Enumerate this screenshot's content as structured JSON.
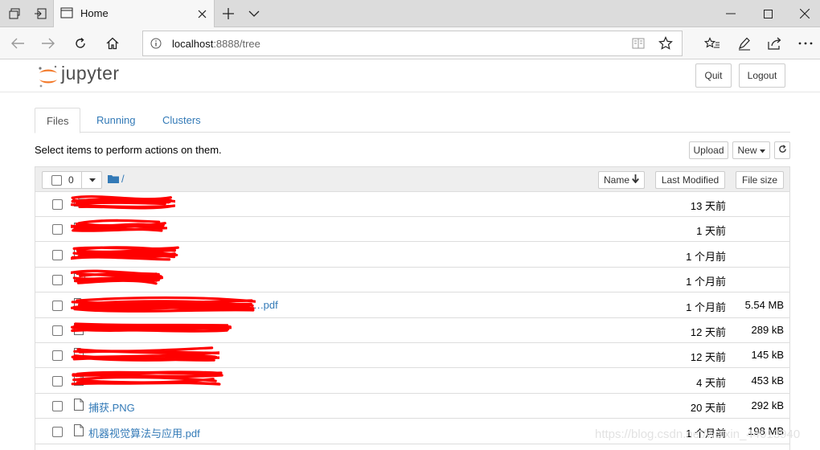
{
  "browser": {
    "tab_title": "Home",
    "url_host": "localhost",
    "url_rest": ":8888/tree"
  },
  "header": {
    "logo_text": "jupyter",
    "quit_label": "Quit",
    "logout_label": "Logout"
  },
  "tabs": [
    {
      "label": "Files"
    },
    {
      "label": "Running"
    },
    {
      "label": "Clusters"
    }
  ],
  "hint": "Select items to perform actions on them.",
  "toolbar": {
    "upload_label": "Upload",
    "new_label": "New"
  },
  "list_header": {
    "selected_count": "0",
    "path": "/",
    "col_name": "Name",
    "col_modified": "Last Modified",
    "col_size": "File size"
  },
  "files": [
    {
      "name": "",
      "modified": "13 天前",
      "size": "",
      "type": "folder",
      "redacted": true
    },
    {
      "name": "",
      "modified": "1 天前",
      "size": "",
      "type": "folder",
      "redacted": true
    },
    {
      "name": "",
      "modified": "1 个月前",
      "size": "",
      "type": "folder",
      "redacted": true
    },
    {
      "name": "",
      "modified": "1 个月前",
      "size": "",
      "type": "folder",
      "redacted": true
    },
    {
      "name": "…….pdf",
      "modified": "1 个月前",
      "size": "5.54 MB",
      "type": "file",
      "redacted": true
    },
    {
      "name": "",
      "modified": "12 天前",
      "size": "289 kB",
      "type": "file",
      "redacted": true
    },
    {
      "name": "",
      "modified": "12 天前",
      "size": "145 kB",
      "type": "file",
      "redacted": true
    },
    {
      "name": "",
      "modified": "4 天前",
      "size": "453 kB",
      "type": "file",
      "redacted": true
    },
    {
      "name": "捕获.PNG",
      "modified": "20 天前",
      "size": "292 kB",
      "type": "file",
      "redacted": false
    },
    {
      "name": "机器视觉算法与应用.pdf",
      "modified": "1 个月前",
      "size": "198 MB",
      "type": "file",
      "redacted": false
    }
  ],
  "watermark": "https://blog.csdn.net/weixin_44013940",
  "colors": {
    "link": "#337ab7",
    "jupyter_orange": "#f37726",
    "redaction": "#ff0000"
  }
}
